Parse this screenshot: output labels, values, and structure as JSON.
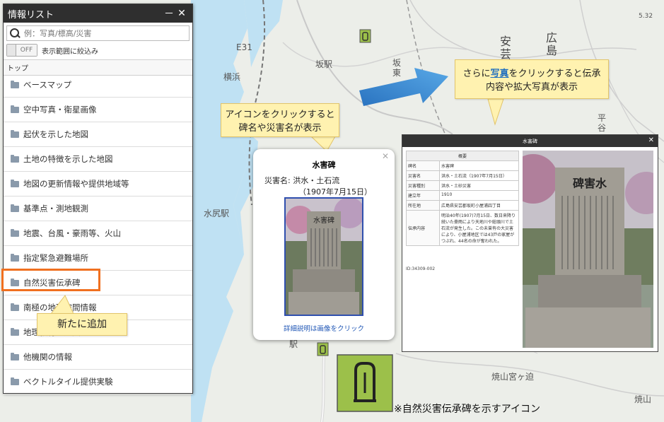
{
  "map": {
    "labels": [
      "横浜",
      "坂駅",
      "坂東",
      "安芸",
      "広島",
      "平谷",
      "水尻駅",
      "焼山宮ヶ迫",
      "焼山",
      "E31",
      "駅",
      "5.32"
    ]
  },
  "panel": {
    "title": "情報リスト",
    "minimize": "－",
    "close": "✕",
    "search_placeholder": "例：写真/標高/災害",
    "toggle_state": "OFF",
    "toggle_label": "表示範囲に絞込み",
    "breadcrumb": "トップ",
    "items": [
      {
        "label": "ベースマップ"
      },
      {
        "label": "空中写真・衛星画像"
      },
      {
        "label": "起伏を示した地図"
      },
      {
        "label": "土地の特徴を示した地図"
      },
      {
        "label": "地図の更新情報や提供地域等"
      },
      {
        "label": "基準点・測地観測"
      },
      {
        "label": "地震、台風・豪雨等、火山"
      },
      {
        "label": "指定緊急避難場所"
      },
      {
        "label": "自然災害伝承碑"
      },
      {
        "label": "南極の地理空間情報"
      },
      {
        "label": "地理教育の道具"
      },
      {
        "label": "他機関の情報"
      },
      {
        "label": "ベクトルタイル提供実験"
      }
    ]
  },
  "callouts": {
    "new": "新たに追加",
    "icon_click_line1": "アイコンをクリックすると",
    "icon_click_line2": "碑名や災害名が表示",
    "photo_click_prefix": "さらに",
    "photo_click_link": "写真",
    "photo_click_suffix": "をクリックすると伝承",
    "photo_click_line2": "内容や拡大写真が表示"
  },
  "popup": {
    "title": "水害碑",
    "disaster_line": "災害名:  洪水・土石流",
    "disaster_date": "（1907年7月15日）",
    "link": "詳細説明は画像をクリック",
    "close": "✕",
    "stone_text": "水害碑"
  },
  "detail": {
    "title": "水害碑",
    "close": "✕",
    "table_header": "概要",
    "rows": [
      {
        "k": "碑名",
        "v": "水害碑"
      },
      {
        "k": "災害名",
        "v": "洪水・土石流（1907年7月15日）"
      },
      {
        "k": "災害種別",
        "v": "洪水・土砂災害"
      },
      {
        "k": "建立年",
        "v": "1910"
      },
      {
        "k": "所在地",
        "v": "広島県安芸郡坂町小屋浦四丁目"
      },
      {
        "k": "伝承内容",
        "v": "明治40年(1907)7月15日、数日来降り続いた豪雨により天地川や総頭川で土石流が発生した。この未曾有の大災害により、小屋浦地区では43戸の家屋がつぶれ、44名の命が奪われた。"
      }
    ],
    "id_text": "ID:34309-002",
    "stone_text": "碑害水"
  },
  "caption": "※自然災害伝承碑を示すアイコン",
  "colors": {
    "accent_orange": "#f07020",
    "callout_bg": "#fff2b0",
    "arrow_blue": "#3a86cf",
    "icon_green": "#9cc04a"
  }
}
